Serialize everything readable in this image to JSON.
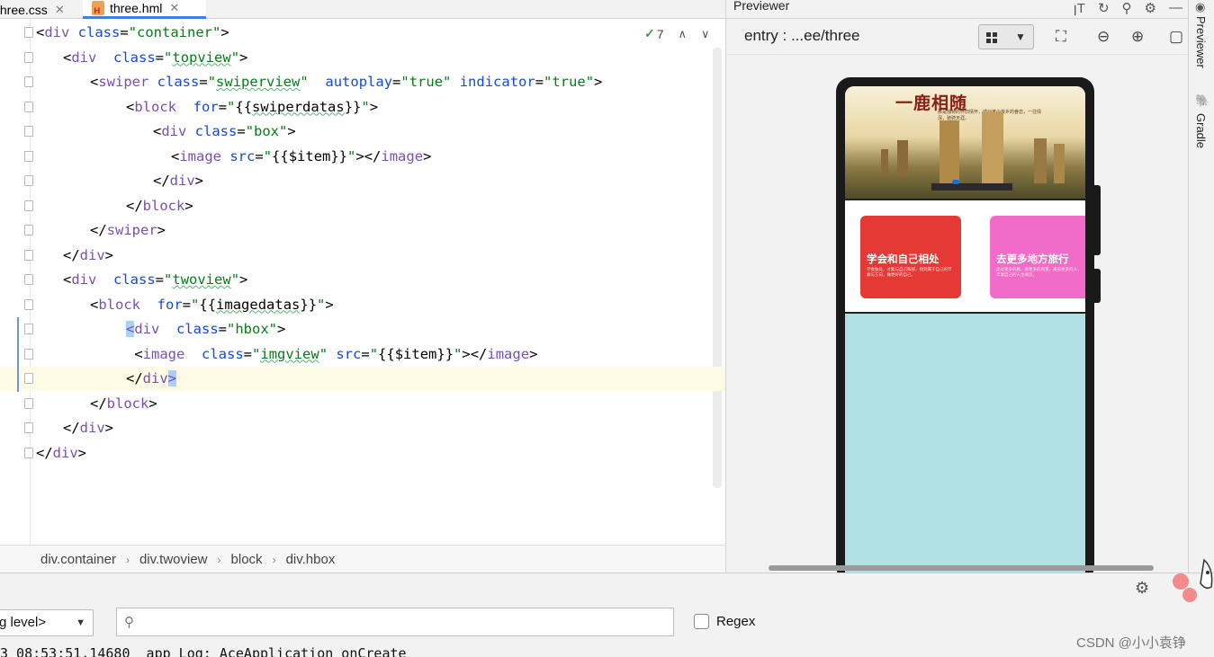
{
  "tabs": [
    {
      "label": "three.css"
    },
    {
      "label": "three.hml"
    }
  ],
  "editor": {
    "inspection_count": "7",
    "lines": [
      {
        "indent": 0,
        "tokens": [
          [
            "p",
            "<"
          ],
          [
            "t",
            "div"
          ],
          [
            "a",
            " class"
          ],
          [
            "p",
            "="
          ],
          [
            "v",
            "\"container\""
          ],
          [
            "p",
            ">"
          ]
        ]
      },
      {
        "indent": 1,
        "tokens": [
          [
            "p",
            "<"
          ],
          [
            "t",
            "div"
          ],
          [
            "a",
            "  class"
          ],
          [
            "p",
            "="
          ],
          [
            "v",
            "\""
          ],
          [
            "vu",
            "topview"
          ],
          [
            "v",
            "\""
          ],
          [
            "p",
            ">"
          ]
        ]
      },
      {
        "indent": 2,
        "tokens": [
          [
            "p",
            "<"
          ],
          [
            "t",
            "swiper"
          ],
          [
            "a",
            " class"
          ],
          [
            "p",
            "="
          ],
          [
            "v",
            "\""
          ],
          [
            "vu",
            "swiperview"
          ],
          [
            "v",
            "\""
          ],
          [
            "a",
            "  autoplay"
          ],
          [
            "p",
            "="
          ],
          [
            "v",
            "\"true\""
          ],
          [
            "a",
            " indicator"
          ],
          [
            "p",
            "="
          ],
          [
            "v",
            "\"true\""
          ],
          [
            "p",
            ">"
          ]
        ]
      },
      {
        "indent": 3,
        "tokens": [
          [
            "p",
            "<"
          ],
          [
            "t",
            "block"
          ],
          [
            "a",
            "  for"
          ],
          [
            "p",
            "="
          ],
          [
            "v",
            "\""
          ],
          [
            "x",
            "{{"
          ],
          [
            "xu",
            "swiperdatas"
          ],
          [
            "x",
            "}}"
          ],
          [
            "v",
            "\""
          ],
          [
            "p",
            ">"
          ]
        ]
      },
      {
        "indent": 4,
        "tokens": [
          [
            "p",
            "<"
          ],
          [
            "t",
            "div"
          ],
          [
            "a",
            " class"
          ],
          [
            "p",
            "="
          ],
          [
            "v",
            "\"box\""
          ],
          [
            "p",
            ">"
          ]
        ]
      },
      {
        "indent": 5,
        "tokens": [
          [
            "p",
            "<"
          ],
          [
            "t",
            "image"
          ],
          [
            "a",
            " src"
          ],
          [
            "p",
            "="
          ],
          [
            "v",
            "\""
          ],
          [
            "x",
            "{{$item}}"
          ],
          [
            "v",
            "\""
          ],
          [
            "p",
            "></"
          ],
          [
            "t",
            "image"
          ],
          [
            "p",
            ">"
          ]
        ]
      },
      {
        "indent": 4,
        "tokens": [
          [
            "p",
            "</"
          ],
          [
            "t",
            "div"
          ],
          [
            "p",
            ">"
          ]
        ]
      },
      {
        "indent": 3,
        "tokens": [
          [
            "p",
            "</"
          ],
          [
            "t",
            "block"
          ],
          [
            "p",
            ">"
          ]
        ]
      },
      {
        "indent": 2,
        "tokens": [
          [
            "p",
            "</"
          ],
          [
            "t",
            "swiper"
          ],
          [
            "p",
            ">"
          ]
        ]
      },
      {
        "indent": 1,
        "tokens": [
          [
            "p",
            "</"
          ],
          [
            "t",
            "div"
          ],
          [
            "p",
            ">"
          ]
        ]
      },
      {
        "indent": 1,
        "tokens": [
          [
            "p",
            "<"
          ],
          [
            "t",
            "div"
          ],
          [
            "a",
            "  class"
          ],
          [
            "p",
            "="
          ],
          [
            "v",
            "\""
          ],
          [
            "vu",
            "twoview"
          ],
          [
            "v",
            "\""
          ],
          [
            "p",
            ">"
          ]
        ]
      },
      {
        "indent": 2,
        "tokens": [
          [
            "p",
            "<"
          ],
          [
            "t",
            "block"
          ],
          [
            "a",
            "  for"
          ],
          [
            "p",
            "="
          ],
          [
            "v",
            "\""
          ],
          [
            "x",
            "{{"
          ],
          [
            "xu",
            "imagedatas"
          ],
          [
            "x",
            "}}"
          ],
          [
            "v",
            "\""
          ],
          [
            "p",
            ">"
          ]
        ]
      },
      {
        "indent": 3,
        "tokens": [
          [
            "c",
            "<"
          ],
          [
            "t",
            "div"
          ],
          [
            "a",
            "  class"
          ],
          [
            "p",
            "="
          ],
          [
            "v",
            "\"hbox\""
          ],
          [
            "p",
            ">"
          ]
        ]
      },
      {
        "indent": 3,
        "tokens": [
          [
            "p",
            " <"
          ],
          [
            "t",
            "image"
          ],
          [
            "a",
            "  class"
          ],
          [
            "p",
            "="
          ],
          [
            "v",
            "\""
          ],
          [
            "vu",
            "imgview"
          ],
          [
            "v",
            "\""
          ],
          [
            "a",
            " src"
          ],
          [
            "p",
            "="
          ],
          [
            "v",
            "\""
          ],
          [
            "x",
            "{{$item}}"
          ],
          [
            "v",
            "\""
          ],
          [
            "p",
            "></"
          ],
          [
            "t",
            "image"
          ],
          [
            "p",
            ">"
          ]
        ]
      },
      {
        "indent": 3,
        "tokens": [
          [
            "p",
            "</"
          ],
          [
            "t",
            "div"
          ],
          [
            "c",
            ">"
          ]
        ]
      },
      {
        "indent": 2,
        "tokens": [
          [
            "p",
            "</"
          ],
          [
            "t",
            "block"
          ],
          [
            "p",
            ">"
          ]
        ]
      },
      {
        "indent": 1,
        "tokens": [
          [
            "p",
            "</"
          ],
          [
            "t",
            "div"
          ],
          [
            "p",
            ">"
          ]
        ]
      },
      {
        "indent": 0,
        "tokens": [
          [
            "p",
            "</"
          ],
          [
            "t",
            "div"
          ],
          [
            "p",
            ">"
          ]
        ]
      }
    ]
  },
  "breadcrumb": [
    "div.container",
    "div.twoview",
    "block",
    "div.hbox"
  ],
  "previewer": {
    "title": "Previewer",
    "entry": "entry : ...ee/three",
    "banner_title": "一鹿相随",
    "banner_sub": "那是独特的怀旧情怀，或对某个故乡的眷恋，一往情深，驰骋天涯。",
    "cards": [
      {
        "title": "学会和自己相处",
        "sub": "学会独处，才能与自己和解，找到属于自己的节奏与方向，做更好的自己。",
        "color": "#e53935"
      },
      {
        "title": "去更多地方旅行",
        "sub": "走过更多的路，看更多的风景，遇见更多的人，丰富自己的人生阅历。",
        "color": "#f06cc8"
      }
    ],
    "screen_bg": "#b0dfe4"
  },
  "side_strip": {
    "previewer_label": "Previewer",
    "gradle_label": "Gradle"
  },
  "bottom": {
    "level_select": "g level>",
    "search_placeholder": "",
    "regex_label": "Regex",
    "log_line": "3 08:53:51.14680  app Log: AceApplication onCreate",
    "watermark": "CSDN @小小袁铮"
  }
}
